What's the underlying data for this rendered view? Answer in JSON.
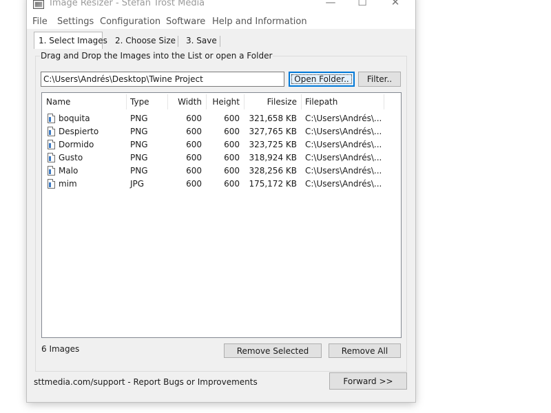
{
  "window": {
    "title": "Image Resizer - Stefan Trost Media",
    "controls": {
      "minimize": "—",
      "maximize": "☐",
      "close": "✕"
    }
  },
  "menu": [
    "File",
    "Settings",
    "Configuration",
    "Software",
    "Help and Information"
  ],
  "tabs": [
    "1. Select Images",
    "2. Choose Size",
    "3. Save"
  ],
  "active_tab": 0,
  "select": {
    "group_label": "Drag and Drop the Images into the List or open a Folder",
    "folder_path": "C:\\Users\\Andrés\\Desktop\\Twine Project",
    "open_folder_label": "Open Folder..",
    "filter_label": "Filter.."
  },
  "table": {
    "columns": [
      "Name",
      "Type",
      "Width",
      "Height",
      "Filesize",
      "Filepath"
    ],
    "rows": [
      [
        "boquita",
        "PNG",
        "600",
        "600",
        "321,658 KB",
        "C:\\Users\\Andrés\\..."
      ],
      [
        "Despierto",
        "PNG",
        "600",
        "600",
        "327,765 KB",
        "C:\\Users\\Andrés\\..."
      ],
      [
        "Dormido",
        "PNG",
        "600",
        "600",
        "323,725 KB",
        "C:\\Users\\Andrés\\..."
      ],
      [
        "Gusto",
        "PNG",
        "600",
        "600",
        "318,924 KB",
        "C:\\Users\\Andrés\\..."
      ],
      [
        "Malo",
        "PNG",
        "600",
        "600",
        "328,256 KB",
        "C:\\Users\\Andrés\\..."
      ],
      [
        "mim",
        "JPG",
        "600",
        "600",
        "175,172 KB",
        "C:\\Users\\Andrés\\..."
      ]
    ]
  },
  "footer": {
    "image_count": "6 Images",
    "remove_selected_label": "Remove Selected",
    "remove_all_label": "Remove All",
    "support_text": "sttmedia.com/support - Report Bugs or Improvements",
    "forward_label": "Forward >>"
  },
  "colors": {
    "focus_accent": "#0078d7",
    "panel_bg": "#f0f0f0",
    "list_bg": "#ffffff"
  }
}
